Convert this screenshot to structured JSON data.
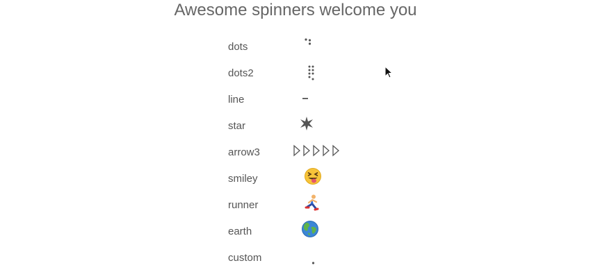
{
  "header": {
    "title": "Awesome spinners welcome you"
  },
  "spinners": [
    {
      "label": "dots",
      "icon": "dots-spinner-icon"
    },
    {
      "label": "dots2",
      "icon": "dots2-spinner-icon"
    },
    {
      "label": "line",
      "icon": "line-spinner-icon"
    },
    {
      "label": "star",
      "icon": "star-spinner-icon"
    },
    {
      "label": "arrow3",
      "icon": "arrow3-spinner-icon"
    },
    {
      "label": "smiley",
      "icon": "smiley-spinner-icon"
    },
    {
      "label": "runner",
      "icon": "runner-spinner-icon"
    },
    {
      "label": "earth",
      "icon": "earth-spinner-icon"
    },
    {
      "label": "custom",
      "icon": "custom-spinner-icon"
    }
  ]
}
